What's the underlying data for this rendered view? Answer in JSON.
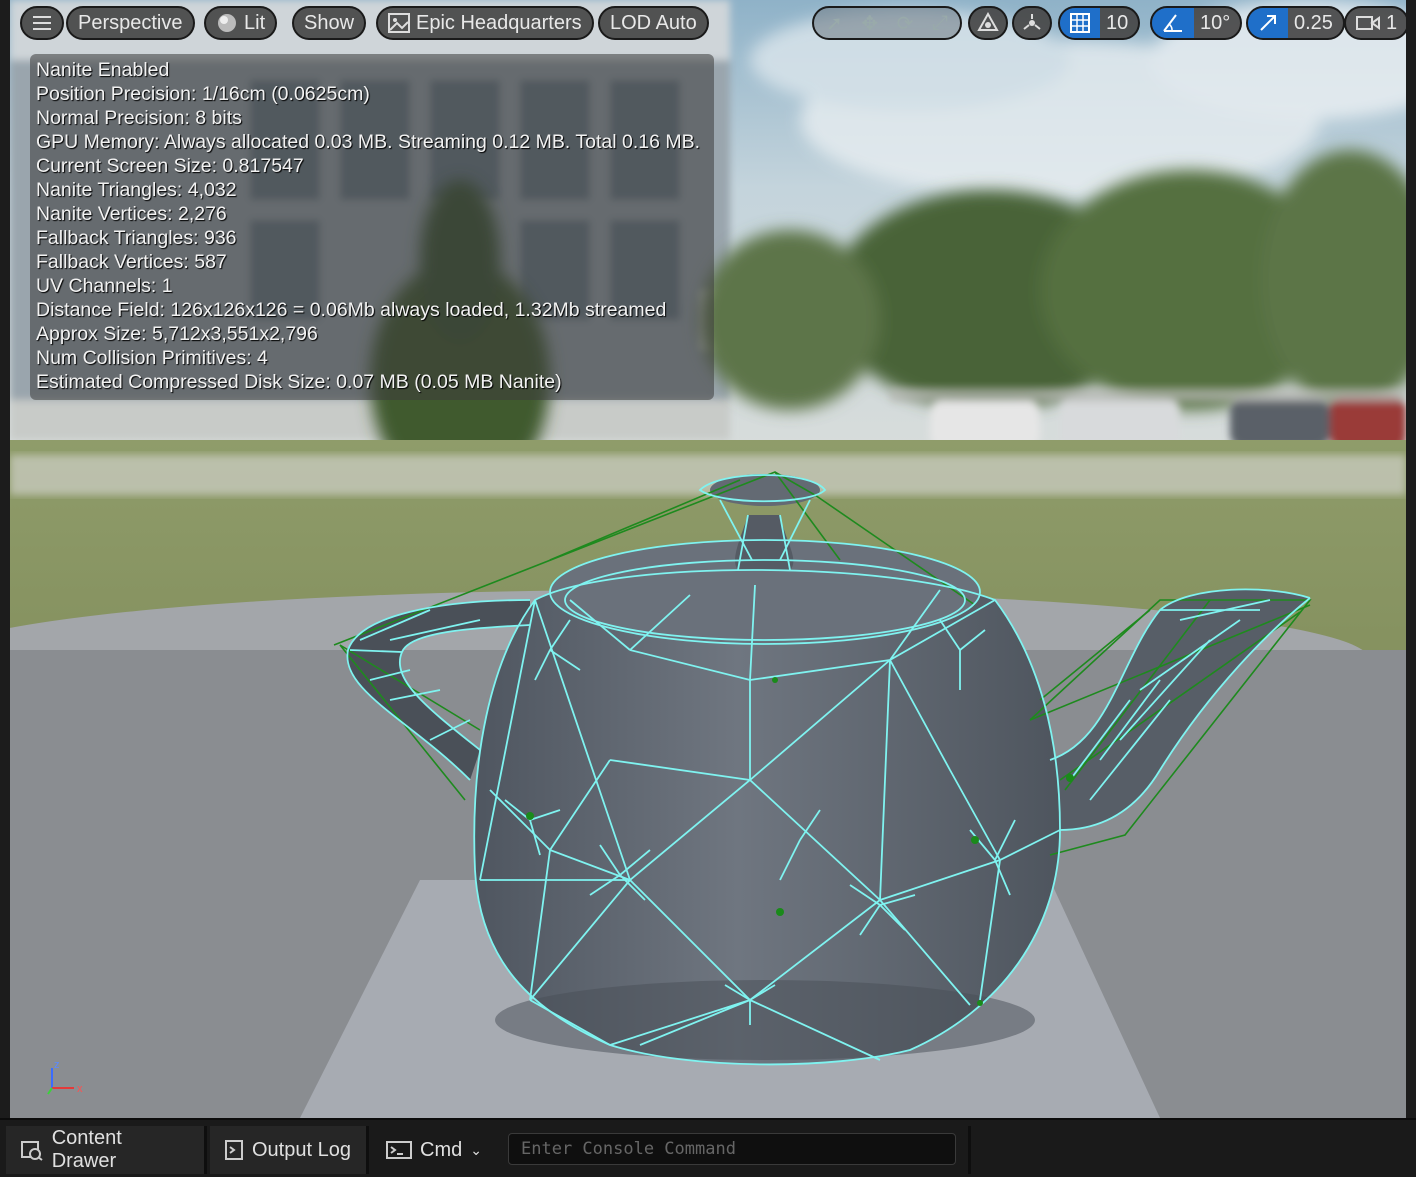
{
  "toolbar": {
    "menu_icon": "hamburger-icon",
    "perspective": "Perspective",
    "lit": "Lit",
    "show": "Show",
    "environment": "Epic Headquarters",
    "lod": "LOD Auto",
    "grid_value": "10",
    "angle_value": "10°",
    "scale_value": "0.25",
    "camera_value": "1"
  },
  "stats": [
    "Nanite Enabled",
    "Position Precision: 1/16cm (0.0625cm)",
    "Normal Precision: 8 bits",
    "GPU Memory: Always allocated 0.03 MB. Streaming 0.12 MB. Total 0.16 MB.",
    "Current Screen Size:  0.817547",
    "Nanite Triangles:  4,032",
    "Nanite Vertices:  2,276",
    "Fallback Triangles:  936",
    "Fallback Vertices:  587",
    "UV Channels:  1",
    "Distance Field:  126x126x126 = 0.06Mb always loaded, 1.32Mb streamed",
    "Approx Size: 5,712x3,551x2,796",
    "Num Collision Primitives:  4",
    "Estimated Compressed Disk Size: 0.07 MB (0.05 MB Nanite)"
  ],
  "axis": {
    "z": "z",
    "x": "x"
  },
  "bottom": {
    "content_drawer": "Content Drawer",
    "output_log": "Output Log",
    "cmd": "Cmd",
    "console_placeholder": "Enter Console Command"
  },
  "colors": {
    "wire": "#7ff3f0",
    "collision": "#1a8a1a",
    "accent": "#1f6fc9"
  }
}
